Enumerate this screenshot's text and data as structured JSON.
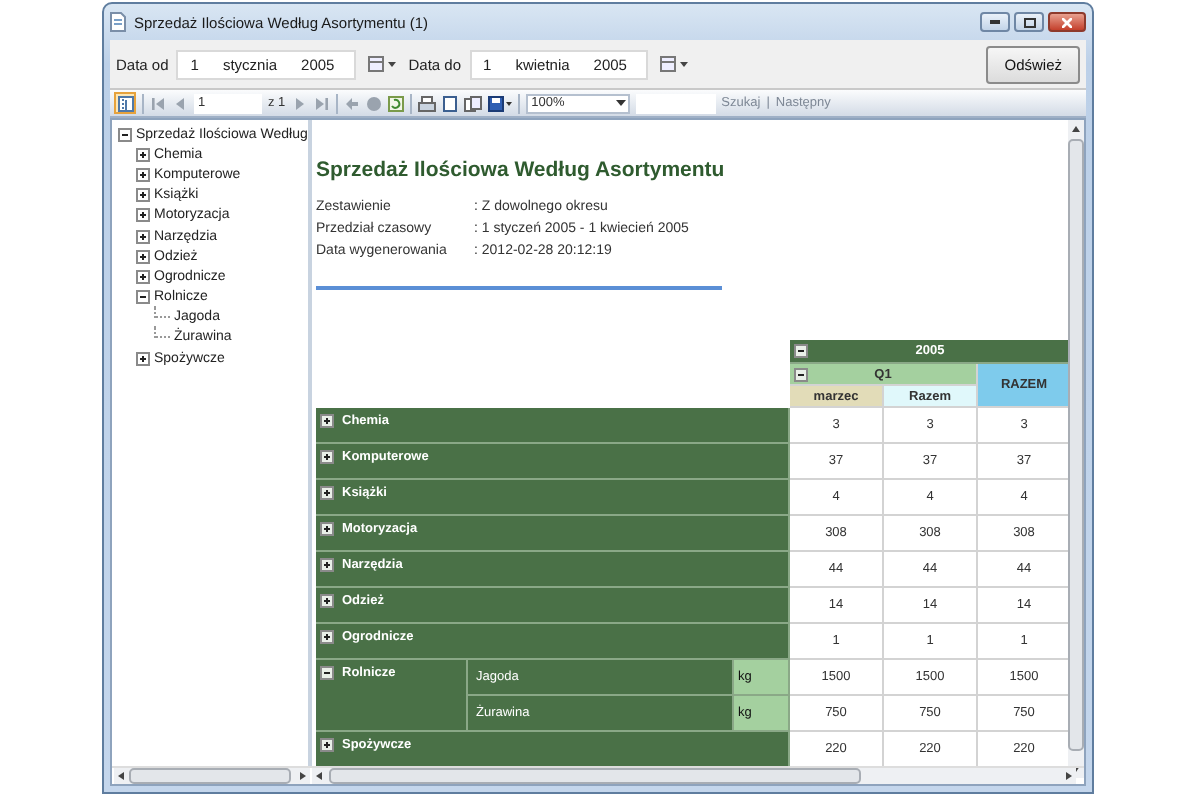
{
  "window": {
    "title": "Sprzedaż Ilościowa Według Asortymentu (1)"
  },
  "filters": {
    "date_from": {
      "label": "Data od",
      "day": "1",
      "month": "stycznia",
      "year": "2005"
    },
    "date_to": {
      "label": "Data do",
      "day": "1",
      "month": "kwietnia",
      "year": "2005"
    },
    "refresh_button": "Odśwież"
  },
  "toolbar": {
    "document_map_on": true,
    "page": "1",
    "page_count": "z 1",
    "zoom": "100%",
    "search_link": "Szukaj",
    "separator": "|",
    "next_link": "Następny"
  },
  "tree": {
    "label": "Sprzedaż Ilościowa Według",
    "expanded": true,
    "children": [
      {
        "label": "Chemia",
        "expanded": false
      },
      {
        "label": "Komputerowe",
        "expanded": false
      },
      {
        "label": "Książki",
        "expanded": false
      },
      {
        "label": "Motoryzacja",
        "expanded": false
      },
      {
        "label": "Narzędzia",
        "expanded": false
      },
      {
        "label": "Odzież",
        "expanded": false
      },
      {
        "label": "Ogrodnicze",
        "expanded": false
      },
      {
        "label": "Rolnicze",
        "expanded": true,
        "children": [
          {
            "label": "Jagoda"
          },
          {
            "label": "Żurawina"
          }
        ]
      },
      {
        "label": "Spożywcze",
        "expanded": false
      }
    ]
  },
  "report": {
    "title": "Sprzedaż Ilościowa Według Asortymentu",
    "info": [
      {
        "label": "Zestawienie",
        "value": ": Z dowolnego okresu"
      },
      {
        "label": "Przedział czasowy",
        "value": ": 1 styczeń 2005 - 1 kwiecień 2005"
      },
      {
        "label": "Data wygenerowania",
        "value": ": 2012-02-28 20:12:19"
      }
    ]
  },
  "pivot": {
    "columns": {
      "year": {
        "label": "2005",
        "expanded": true
      },
      "quarter": {
        "label": "Q1",
        "expanded": true
      },
      "month": "marzec",
      "subtotal": "Razem",
      "total": "RAZEM"
    },
    "rows": [
      {
        "label": "Chemia",
        "expanded": false,
        "values": [
          "3",
          "3",
          "3"
        ]
      },
      {
        "label": "Komputerowe",
        "expanded": false,
        "values": [
          "37",
          "37",
          "37"
        ]
      },
      {
        "label": "Książki",
        "expanded": false,
        "values": [
          "4",
          "4",
          "4"
        ]
      },
      {
        "label": "Motoryzacja",
        "expanded": false,
        "values": [
          "308",
          "308",
          "308"
        ]
      },
      {
        "label": "Narzędzia",
        "expanded": false,
        "values": [
          "44",
          "44",
          "44"
        ]
      },
      {
        "label": "Odzież",
        "expanded": false,
        "values": [
          "14",
          "14",
          "14"
        ]
      },
      {
        "label": "Ogrodnicze",
        "expanded": false,
        "values": [
          "1",
          "1",
          "1"
        ]
      },
      {
        "label": "Rolnicze",
        "expanded": true,
        "children": [
          {
            "label": "Jagoda",
            "unit": "kg",
            "values": [
              "1500",
              "1500",
              "1500"
            ]
          },
          {
            "label": "Żurawina",
            "unit": "kg",
            "values": [
              "750",
              "750",
              "750"
            ]
          }
        ]
      },
      {
        "label": "Spożywcze",
        "expanded": false,
        "values": [
          "220",
          "220",
          "220"
        ]
      }
    ]
  }
}
